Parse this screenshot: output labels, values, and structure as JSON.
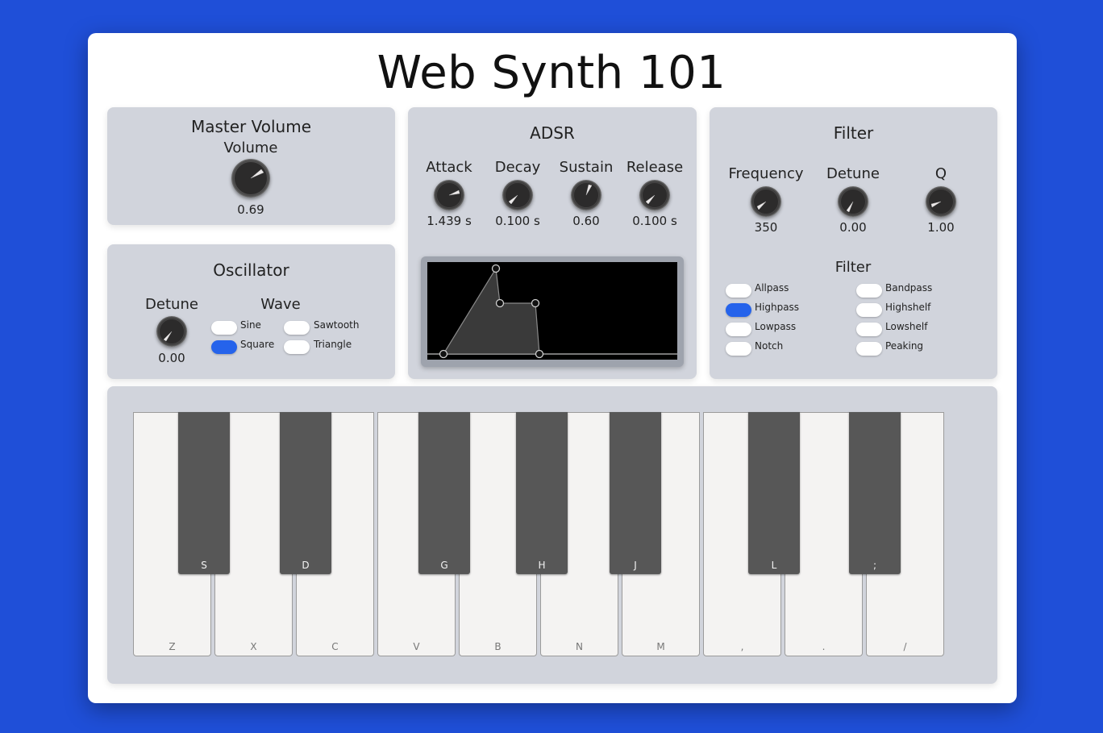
{
  "app": {
    "title": "Web Synth 101"
  },
  "master": {
    "title": "Master Volume",
    "volume_label": "Volume",
    "volume_value": "0.69",
    "volume": 0.69
  },
  "oscillator": {
    "title": "Oscillator",
    "detune_label": "Detune",
    "detune_value": "0.00",
    "wave_label": "Wave",
    "waves": [
      {
        "label": "Sine",
        "selected": false
      },
      {
        "label": "Sawtooth",
        "selected": false
      },
      {
        "label": "Square",
        "selected": true
      },
      {
        "label": "Triangle",
        "selected": false
      }
    ]
  },
  "adsr": {
    "title": "ADSR",
    "attack": {
      "label": "Attack",
      "value": "1.439 s"
    },
    "decay": {
      "label": "Decay",
      "value": "0.100 s"
    },
    "sustain": {
      "label": "Sustain",
      "value": "0.60"
    },
    "release": {
      "label": "Release",
      "value": "0.100 s"
    }
  },
  "filter": {
    "title": "Filter",
    "frequency": {
      "label": "Frequency",
      "value": "350"
    },
    "detune": {
      "label": "Detune",
      "value": "0.00"
    },
    "q": {
      "label": "Q",
      "value": "1.00"
    },
    "type_title": "Filter",
    "types": [
      {
        "label": "Allpass",
        "selected": false
      },
      {
        "label": "Bandpass",
        "selected": false
      },
      {
        "label": "Highpass",
        "selected": true
      },
      {
        "label": "Highshelf",
        "selected": false
      },
      {
        "label": "Lowpass",
        "selected": false
      },
      {
        "label": "Lowshelf",
        "selected": false
      },
      {
        "label": "Notch",
        "selected": false
      },
      {
        "label": "Peaking",
        "selected": false
      }
    ]
  },
  "keyboard": {
    "white_keys": [
      "Z",
      "X",
      "C",
      "V",
      "B",
      "N",
      "M",
      ",",
      ".",
      "/"
    ],
    "black_keys": [
      "S",
      "D",
      "G",
      "H",
      "J",
      "L",
      ";"
    ]
  },
  "colors": {
    "background": "#1f4fd8",
    "accent": "#2563eb",
    "panel": "#d1d4dc"
  }
}
